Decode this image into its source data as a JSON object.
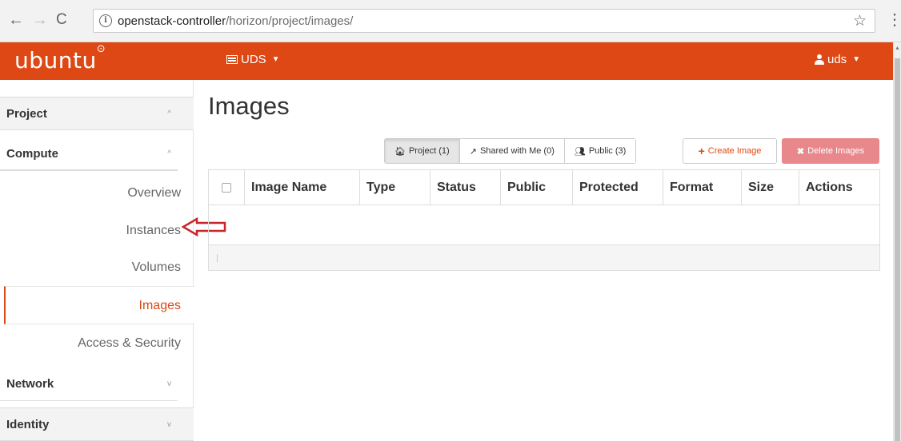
{
  "browser": {
    "back_icon": "←",
    "forward_icon": "→",
    "reload_icon": "C",
    "info_icon": "i",
    "url_host": "openstack-controller",
    "url_path": "/horizon/project/images/",
    "bookmark_icon": "☆",
    "menu_icon": "⋮"
  },
  "header": {
    "logo": "ubuntu",
    "logo_mark": "⊙",
    "project_label": "UDS",
    "caret": "▼",
    "user_label": "uds"
  },
  "sidebar": {
    "sections": {
      "project": "Project",
      "compute": "Compute",
      "network": "Network",
      "identity": "Identity"
    },
    "chevron_up": "^",
    "chevron_down": "v",
    "items": {
      "overview": "Overview",
      "instances": "Instances",
      "volumes": "Volumes",
      "images": "Images",
      "access": "Access & Security"
    }
  },
  "main": {
    "title": "Images",
    "filters": {
      "project": "Project (1)",
      "shared": "Shared with Me (0)",
      "public": "Public (3)"
    },
    "create_label": "Create Image",
    "delete_label": "Delete Images",
    "columns": [
      "Image Name",
      "Type",
      "Status",
      "Public",
      "Protected",
      "Format",
      "Size",
      "Actions"
    ]
  },
  "colors": {
    "brand": "#dd4814",
    "delete_disabled": "#e8888c",
    "annotation_arrow": "#c9252c"
  }
}
